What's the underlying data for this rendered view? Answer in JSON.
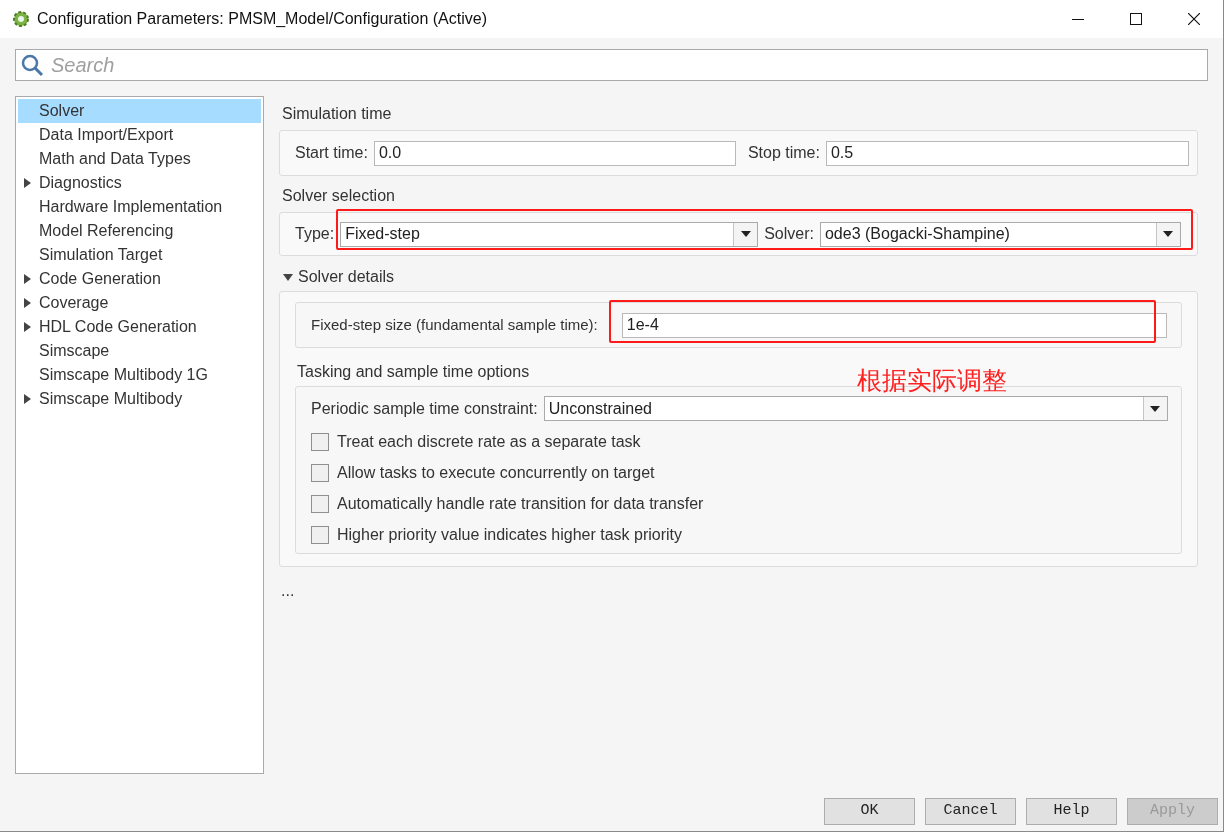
{
  "window": {
    "title": "Configuration Parameters: PMSM_Model/Configuration (Active)"
  },
  "search": {
    "placeholder": "Search"
  },
  "sidebar": {
    "items": [
      {
        "label": "Solver",
        "expander": false,
        "selected": true
      },
      {
        "label": "Data Import/Export",
        "expander": false,
        "selected": false
      },
      {
        "label": "Math and Data Types",
        "expander": false,
        "selected": false
      },
      {
        "label": "Diagnostics",
        "expander": true,
        "selected": false
      },
      {
        "label": "Hardware Implementation",
        "expander": false,
        "selected": false
      },
      {
        "label": "Model Referencing",
        "expander": false,
        "selected": false
      },
      {
        "label": "Simulation Target",
        "expander": false,
        "selected": false
      },
      {
        "label": "Code Generation",
        "expander": true,
        "selected": false
      },
      {
        "label": "Coverage",
        "expander": true,
        "selected": false
      },
      {
        "label": "HDL Code Generation",
        "expander": true,
        "selected": false
      },
      {
        "label": "Simscape",
        "expander": false,
        "selected": false
      },
      {
        "label": "Simscape Multibody 1G",
        "expander": false,
        "selected": false
      },
      {
        "label": "Simscape Multibody",
        "expander": true,
        "selected": false
      }
    ]
  },
  "simulation_time": {
    "title": "Simulation time",
    "fields": [
      {
        "label": "Start time:",
        "value": "0.0"
      },
      {
        "label": "Stop time:",
        "value": "0.5"
      }
    ]
  },
  "solver_selection": {
    "title": "Solver selection",
    "highlighted": true,
    "type": {
      "label": "Type:",
      "value": "Fixed-step"
    },
    "solver": {
      "label": "Solver:",
      "value": "ode3 (Bogacki-Shampine)"
    }
  },
  "solver_details": {
    "title": "Solver details",
    "expanded": true,
    "step_size": {
      "label": "Fixed-step size (fundamental sample time):",
      "value": "1e-4",
      "highlighted": true
    },
    "tasking": {
      "title": "Tasking and sample time options",
      "constraint": {
        "label": "Periodic sample time constraint:",
        "value": "Unconstrained"
      },
      "options": [
        {
          "label": "Treat each discrete rate as a separate task",
          "checked": false
        },
        {
          "label": "Allow tasks to execute concurrently on target",
          "checked": false
        },
        {
          "label": "Automatically handle rate transition for data transfer",
          "checked": false
        },
        {
          "label": "Higher priority value indicates higher task priority",
          "checked": false
        }
      ]
    }
  },
  "more": "...",
  "annotation": {
    "note": "根据实际调整"
  },
  "buttons": [
    {
      "label": "OK",
      "disabled": false
    },
    {
      "label": "Cancel",
      "disabled": false
    },
    {
      "label": "Help",
      "disabled": false
    },
    {
      "label": "Apply",
      "disabled": true
    }
  ]
}
